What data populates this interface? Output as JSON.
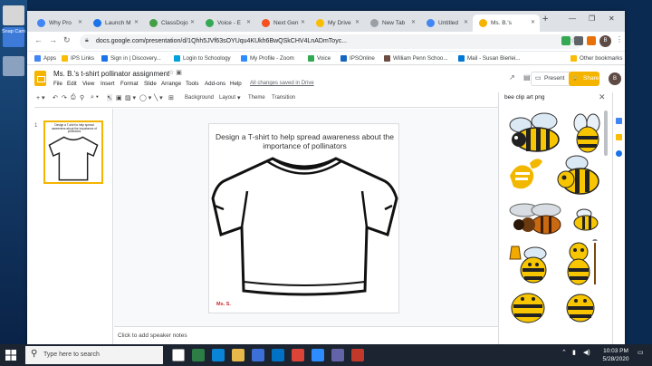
{
  "desktop": {
    "snap_label": "Snap Cam"
  },
  "browser": {
    "tabs": [
      {
        "label": "Why Pro",
        "color": "#4285f4"
      },
      {
        "label": "Launch M",
        "color": "#1a73e8"
      },
      {
        "label": "ClassDojo",
        "color": "#43a047"
      },
      {
        "label": "Voice - E",
        "color": "#34a853"
      },
      {
        "label": "Next Gen",
        "color": "#f4511e"
      },
      {
        "label": "My Drive",
        "color": "#fbbc04"
      },
      {
        "label": "New Tab",
        "color": "#9aa0a6"
      },
      {
        "label": "Untitled",
        "color": "#4285f4"
      },
      {
        "label": "Ms. B.'s",
        "color": "#f4b400"
      }
    ],
    "url": "docs.google.com/presentation/d/1Qhh5JVf63sOYUqu4KUkh6BwQSkCHV4LnADmToyc...",
    "bookmarks": [
      {
        "label": "Apps",
        "color": "#4285f4"
      },
      {
        "label": "IPS Links",
        "color": "#fbbc04"
      },
      {
        "label": "Sign in | Discovery...",
        "color": "#1a73e8"
      },
      {
        "label": "Login to Schoology",
        "color": "#00a0df"
      },
      {
        "label": "My Profile - Zoom",
        "color": "#2d8cff"
      },
      {
        "label": "Voice",
        "color": "#34a853"
      },
      {
        "label": "IPSOnline",
        "color": "#1565c0"
      },
      {
        "label": "William Penn Schoo...",
        "color": "#6d4c41"
      },
      {
        "label": "Mail - Susan Bierlei...",
        "color": "#0078d4"
      },
      {
        "label": "Other bookmarks",
        "color": "#fbbc04"
      }
    ]
  },
  "slides": {
    "title": "Ms. B.'s t-shirt pollinator assignment",
    "menus": [
      "File",
      "Edit",
      "View",
      "Insert",
      "Format",
      "Slide",
      "Arrange",
      "Tools",
      "Add-ons",
      "Help"
    ],
    "saved_status": "All changes saved in Drive",
    "present_label": "Present",
    "share_label": "Share",
    "account_initial": "B",
    "toolbar_text": {
      "background": "Background",
      "layout": "Layout",
      "theme": "Theme",
      "transition": "Transition"
    },
    "slide_number": "1",
    "slide_text": "Design a T-shirt to help spread awareness about the importance of pollinators",
    "signature": "Ms. S.",
    "speaker_notes_placeholder": "Click to add speaker notes",
    "search_query": "bee clip art png"
  },
  "taskbar": {
    "search_placeholder": "Type here to search",
    "time": "10:03 PM",
    "date": "5/28/2020"
  }
}
